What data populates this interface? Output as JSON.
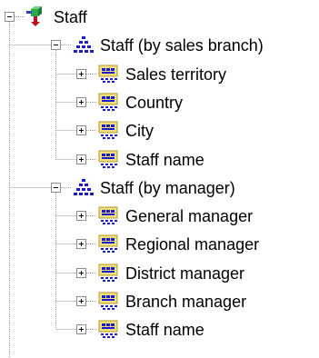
{
  "tree": {
    "root": {
      "label": "Staff",
      "state": "expanded",
      "icon": "cube-arrow-icon"
    },
    "groups": [
      {
        "label": "Staff (by sales branch)",
        "state": "expanded",
        "icon": "hierarchy-pyramid-icon",
        "levels": [
          {
            "label": "Sales territory",
            "state": "collapsed",
            "icon": "level-icon"
          },
          {
            "label": "Country",
            "state": "collapsed",
            "icon": "level-icon"
          },
          {
            "label": "City",
            "state": "collapsed",
            "icon": "level-icon"
          },
          {
            "label": "Staff name",
            "state": "collapsed",
            "icon": "level-icon"
          }
        ]
      },
      {
        "label": "Staff (by manager)",
        "state": "expanded",
        "icon": "hierarchy-pyramid-icon",
        "levels": [
          {
            "label": "General manager",
            "state": "collapsed",
            "icon": "level-icon"
          },
          {
            "label": "Regional manager",
            "state": "collapsed",
            "icon": "level-icon"
          },
          {
            "label": "District manager",
            "state": "collapsed",
            "icon": "level-icon"
          },
          {
            "label": "Branch manager",
            "state": "collapsed",
            "icon": "level-icon"
          },
          {
            "label": "Staff name",
            "state": "collapsed",
            "icon": "level-icon"
          }
        ]
      }
    ]
  },
  "colors": {
    "connector": "#9a9a9a",
    "toggle_border": "#8c8c8c",
    "level_icon_fill": "#f0e080",
    "level_icon_blue": "#1a1ad0"
  }
}
